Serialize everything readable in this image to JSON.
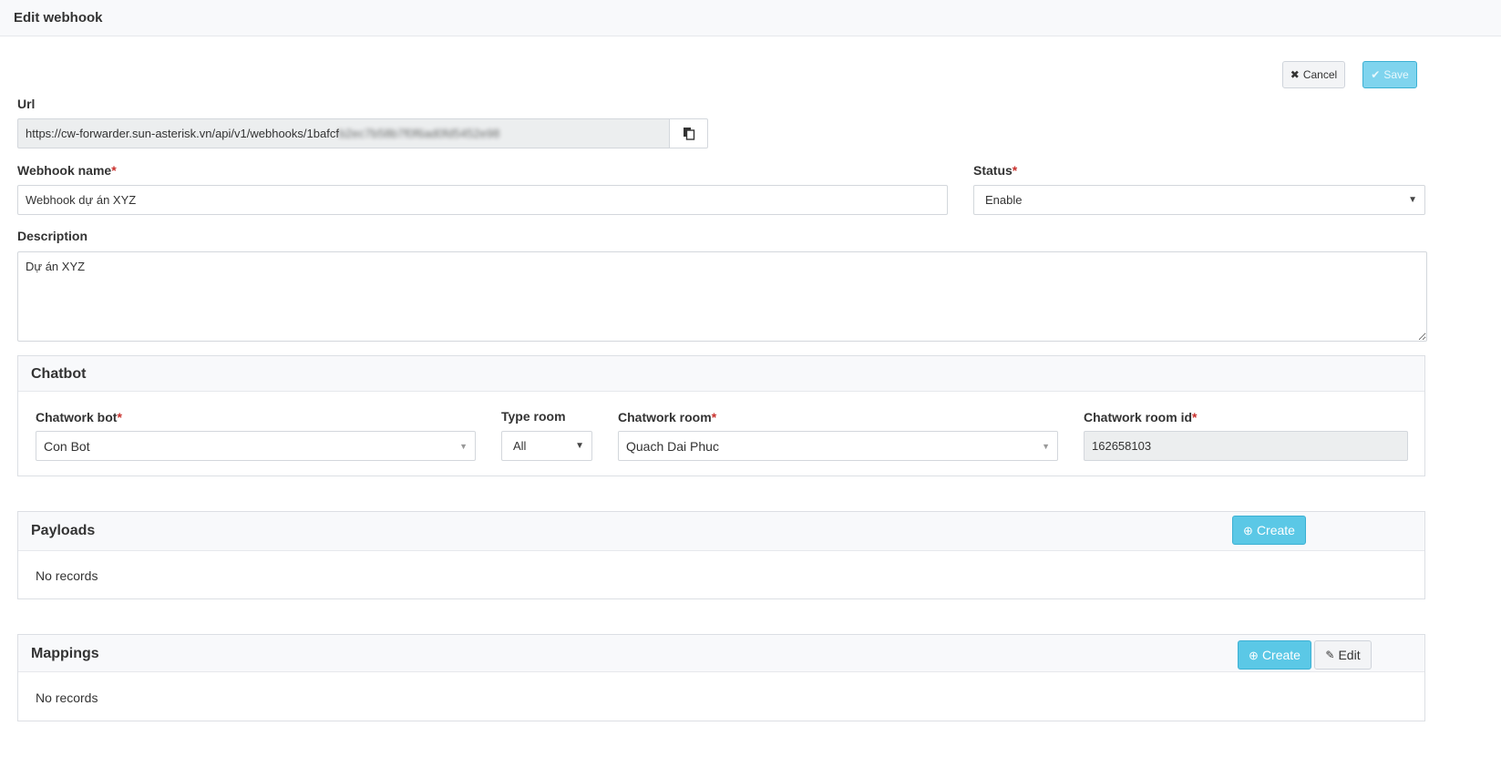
{
  "header": {
    "title": "Edit webhook"
  },
  "actions": {
    "cancel_label": "Cancel",
    "save_label": "Save"
  },
  "url": {
    "label": "Url",
    "value_visible": "https://cw-forwarder.sun-asterisk.vn/api/v1/webhooks/1bafcf",
    "value_obscured": "b2ec7b58b7f0f6ad0fd5452e98"
  },
  "webhook_name": {
    "label": "Webhook name",
    "required": "*",
    "value": "Webhook dự án XYZ"
  },
  "status": {
    "label": "Status",
    "required": "*",
    "value": "Enable"
  },
  "description": {
    "label": "Description",
    "value": "Dự án XYZ"
  },
  "chatbot": {
    "title": "Chatbot",
    "bot": {
      "label": "Chatwork bot",
      "required": "*",
      "value": "Con Bot"
    },
    "type_room": {
      "label": "Type room",
      "value": "All"
    },
    "room": {
      "label": "Chatwork room",
      "required": "*",
      "value": "Quach Dai Phuc"
    },
    "room_id": {
      "label": "Chatwork room id",
      "required": "*",
      "value": "162658103"
    }
  },
  "payloads": {
    "title": "Payloads",
    "create_label": "Create",
    "empty_text": "No records"
  },
  "mappings": {
    "title": "Mappings",
    "create_label": "Create",
    "edit_label": "Edit",
    "empty_text": "No records"
  },
  "colors": {
    "accent": "#5bc8e6",
    "required": "#c9302c"
  }
}
